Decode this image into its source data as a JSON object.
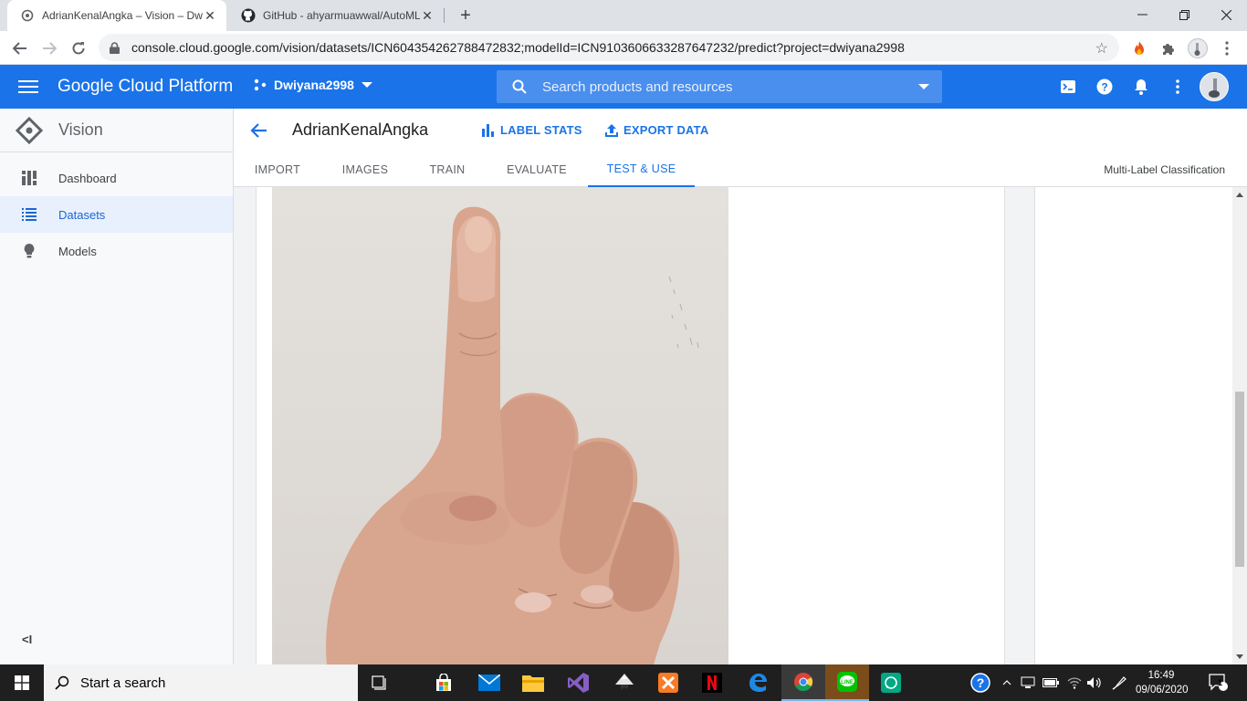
{
  "browser": {
    "tabs": [
      {
        "title": "AdrianKenalAngka – Vision – Dwi",
        "active": true
      },
      {
        "title": "GitHub - ahyarmuawwal/AutoML",
        "active": false
      }
    ],
    "url": "console.cloud.google.com/vision/datasets/ICN604354262788472832;modelId=ICN9103606633287647232/predict?project=dwiyana2998"
  },
  "gcp": {
    "title": "Google Cloud Platform",
    "project": "Dwiyana2998",
    "search_placeholder": "Search products and resources"
  },
  "sidebar": {
    "product": "Vision",
    "items": [
      {
        "label": "Dashboard",
        "icon": "dashboard-icon",
        "active": false
      },
      {
        "label": "Datasets",
        "icon": "list-icon",
        "active": true
      },
      {
        "label": "Models",
        "icon": "lightbulb-icon",
        "active": false
      }
    ],
    "collapse": "<I"
  },
  "dataset": {
    "name": "AdrianKenalAngka",
    "label_stats": "LABEL STATS",
    "export_data": "EXPORT DATA"
  },
  "tabs": [
    "IMPORT",
    "IMAGES",
    "TRAIN",
    "EVALUATE",
    "TEST & USE"
  ],
  "active_tab": "TEST & USE",
  "classification_type": "Multi-Label Classification",
  "taskbar": {
    "search_placeholder": "Start a search",
    "time": "16:49",
    "date": "09/06/2020",
    "notifications": "1"
  },
  "colors": {
    "gcp_blue": "#1a73e8",
    "active_tab": "#1a73e8"
  }
}
